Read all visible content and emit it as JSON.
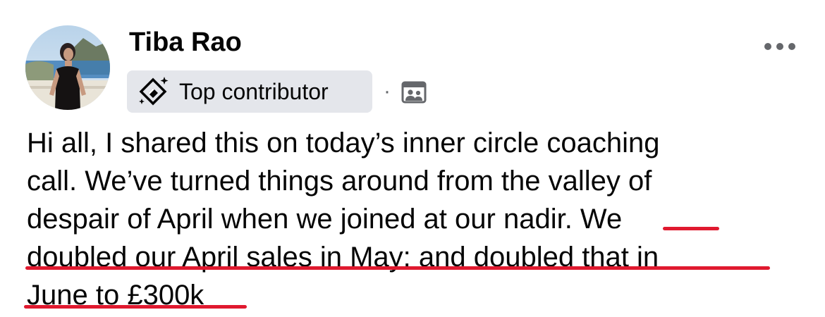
{
  "post": {
    "author": {
      "name": "Tiba Rao",
      "badge_label": "Top contributor",
      "badge_icon": "top-contributor-diamond-icon",
      "audience_icon": "group-members-icon"
    },
    "separator": "·",
    "menu_icon": "more-options-icon",
    "body": {
      "lines": [
        "Hi all, I shared this on today’s inner circle coaching",
        "call. We’ve turned things around from the valley of",
        "despair of April when we joined at our nadir. We",
        "doubled our April sales in May: and doubled that in",
        "June to £300k"
      ],
      "highlight_color": "#e0192f"
    }
  }
}
